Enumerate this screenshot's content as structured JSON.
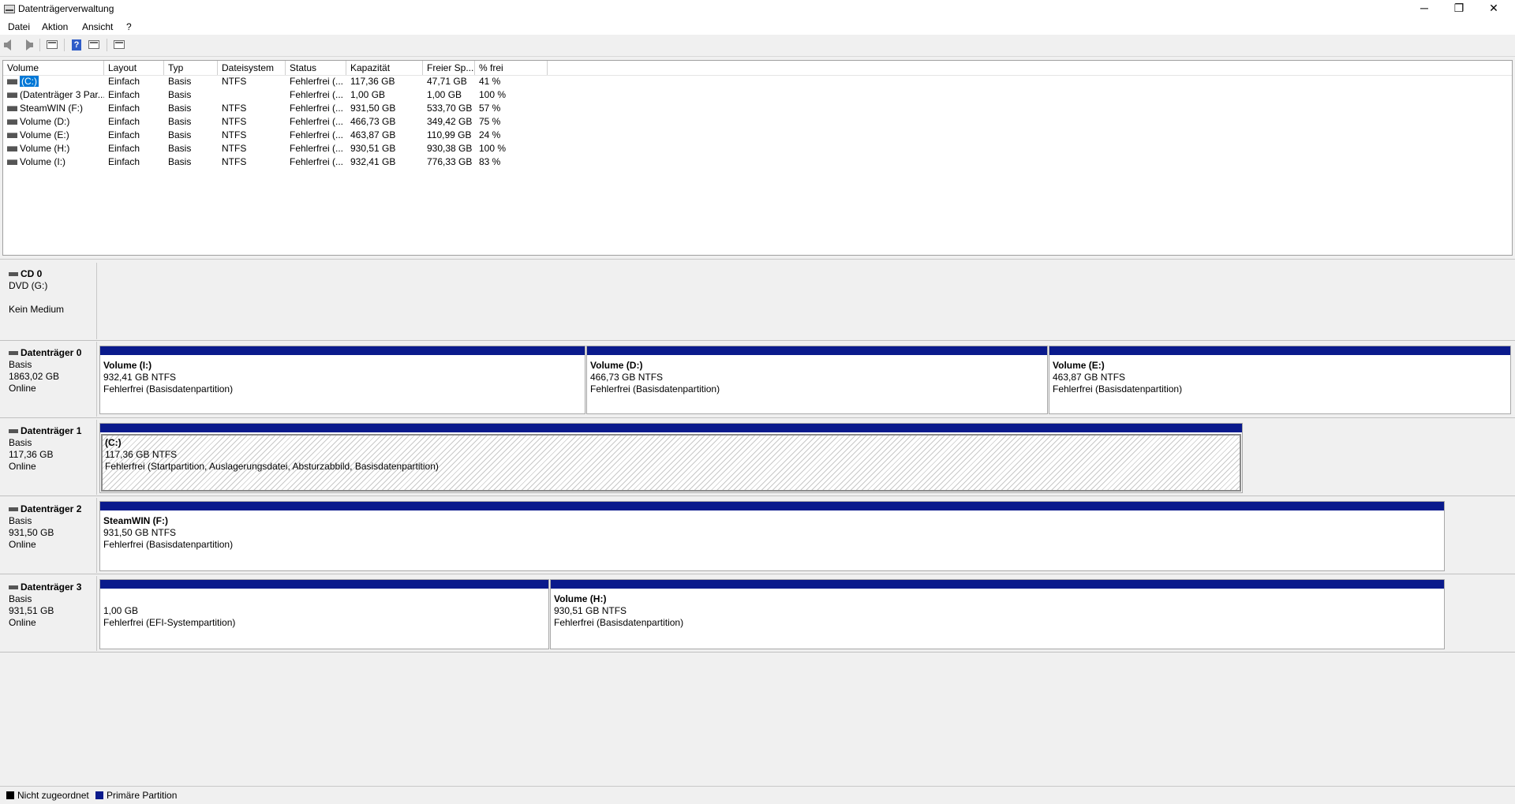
{
  "window": {
    "title": "Datenträgerverwaltung",
    "minimize_glyph": "─",
    "maximize_glyph": "❐",
    "close_glyph": "✕"
  },
  "menu": {
    "items": [
      "Datei",
      "Aktion",
      "Ansicht",
      "?"
    ]
  },
  "toolbar": {
    "icons": [
      "back-arrow-icon",
      "forward-arrow-icon",
      "console-tree-icon",
      "help-icon",
      "properties-icon",
      "list-view-icon"
    ],
    "help_glyph": "?"
  },
  "volume_list": {
    "columns": [
      "Volume",
      "Layout",
      "Typ",
      "Dateisystem",
      "Status",
      "Kapazität",
      "Freier Sp...",
      "% frei"
    ],
    "rows": [
      {
        "volume": "(C:)",
        "layout": "Einfach",
        "typ": "Basis",
        "fs": "NTFS",
        "status": "Fehlerfrei (...",
        "capacity": "117,36 GB",
        "free": "47,71 GB",
        "pct": "41 %",
        "selected": true
      },
      {
        "volume": "(Datenträger 3 Par...",
        "layout": "Einfach",
        "typ": "Basis",
        "fs": "",
        "status": "Fehlerfrei (...",
        "capacity": "1,00 GB",
        "free": "1,00 GB",
        "pct": "100 %"
      },
      {
        "volume": "SteamWIN (F:)",
        "layout": "Einfach",
        "typ": "Basis",
        "fs": "NTFS",
        "status": "Fehlerfrei (...",
        "capacity": "931,50 GB",
        "free": "533,70 GB",
        "pct": "57 %"
      },
      {
        "volume": "Volume (D:)",
        "layout": "Einfach",
        "typ": "Basis",
        "fs": "NTFS",
        "status": "Fehlerfrei (...",
        "capacity": "466,73 GB",
        "free": "349,42 GB",
        "pct": "75 %"
      },
      {
        "volume": "Volume (E:)",
        "layout": "Einfach",
        "typ": "Basis",
        "fs": "NTFS",
        "status": "Fehlerfrei (...",
        "capacity": "463,87 GB",
        "free": "110,99 GB",
        "pct": "24 %"
      },
      {
        "volume": "Volume (H:)",
        "layout": "Einfach",
        "typ": "Basis",
        "fs": "NTFS",
        "status": "Fehlerfrei (...",
        "capacity": "930,51 GB",
        "free": "930,38 GB",
        "pct": "100 %"
      },
      {
        "volume": "Volume (I:)",
        "layout": "Einfach",
        "typ": "Basis",
        "fs": "NTFS",
        "status": "Fehlerfrei (...",
        "capacity": "932,41 GB",
        "free": "776,33 GB",
        "pct": "83 %"
      }
    ]
  },
  "disks": {
    "cd0": {
      "name": "CD 0",
      "drive": "DVD (G:)",
      "status": "Kein Medium"
    },
    "d0": {
      "name": "Datenträger 0",
      "type": "Basis",
      "size": "1863,02 GB",
      "state": "Online",
      "parts": [
        {
          "title": "Volume  (I:)",
          "size": "932,41 GB NTFS",
          "status": "Fehlerfrei (Basisdatenpartition)"
        },
        {
          "title": "Volume  (D:)",
          "size": "466,73 GB NTFS",
          "status": "Fehlerfrei (Basisdatenpartition)"
        },
        {
          "title": "Volume  (E:)",
          "size": "463,87 GB NTFS",
          "status": "Fehlerfrei (Basisdatenpartition)"
        }
      ]
    },
    "d1": {
      "name": "Datenträger 1",
      "type": "Basis",
      "size": "117,36 GB",
      "state": "Online",
      "parts": [
        {
          "title": "(C:)",
          "size": "117,36 GB NTFS",
          "status": "Fehlerfrei (Startpartition, Auslagerungsdatei, Absturzabbild, Basisdatenpartition)"
        }
      ]
    },
    "d2": {
      "name": "Datenträger 2",
      "type": "Basis",
      "size": "931,50 GB",
      "state": "Online",
      "parts": [
        {
          "title": "SteamWIN  (F:)",
          "size": "931,50 GB NTFS",
          "status": "Fehlerfrei (Basisdatenpartition)"
        }
      ]
    },
    "d3": {
      "name": "Datenträger 3",
      "type": "Basis",
      "size": "931,51 GB",
      "state": "Online",
      "parts": [
        {
          "title": "",
          "size": "1,00 GB",
          "status": "Fehlerfrei (EFI-Systempartition)"
        },
        {
          "title": "Volume  (H:)",
          "size": "930,51 GB NTFS",
          "status": "Fehlerfrei (Basisdatenpartition)"
        }
      ]
    }
  },
  "legend": {
    "unallocated": "Nicht zugeordnet",
    "primary": "Primäre Partition",
    "unallocated_color": "#000000",
    "primary_color": "#0a1a8c"
  }
}
